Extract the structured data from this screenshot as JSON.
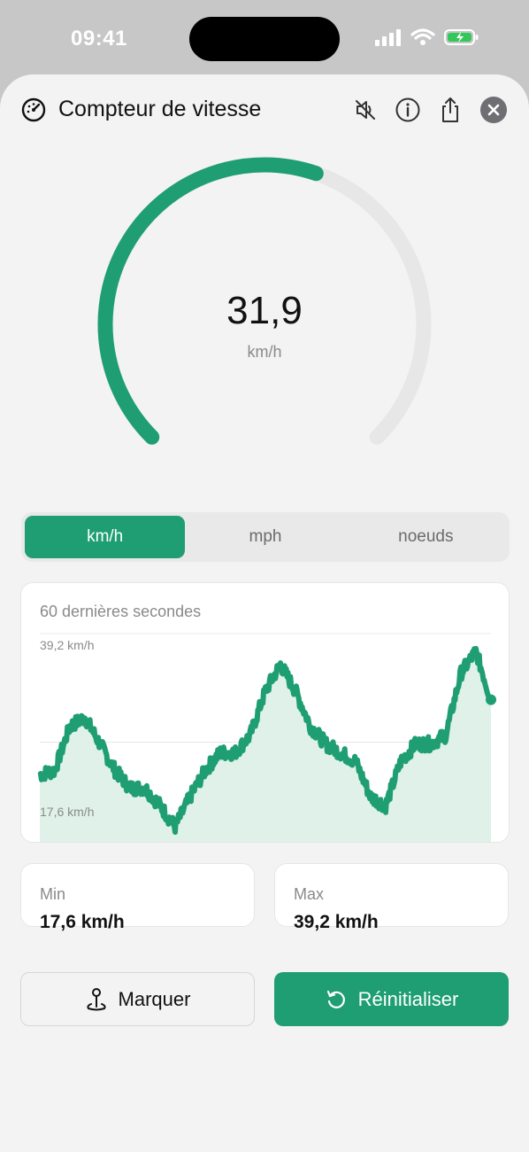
{
  "status": {
    "time": "09:41"
  },
  "header": {
    "title": "Compteur de vitesse",
    "icons": [
      "speedometer-icon",
      "mute-icon",
      "info-icon",
      "share-icon",
      "close-icon"
    ]
  },
  "gauge": {
    "value": "31,9",
    "unit": "km/h",
    "fill_fraction": 0.57
  },
  "units": {
    "options": [
      "km/h",
      "mph",
      "noeuds"
    ],
    "selected": "km/h"
  },
  "chart": {
    "title": "60 dernières secondes",
    "max_label": "39,2 km/h",
    "min_label": "17,6 km/h"
  },
  "chart_data": {
    "type": "area",
    "x": [
      0,
      2,
      4,
      6,
      8,
      10,
      12,
      14,
      16,
      18,
      20,
      22,
      24,
      26,
      28,
      30,
      32,
      34,
      36,
      38,
      40,
      42,
      44,
      46,
      48,
      50,
      52,
      54,
      56,
      58,
      60
    ],
    "values": [
      23.5,
      24,
      29,
      30,
      27,
      24,
      22,
      22,
      20,
      17.6,
      21,
      24,
      26,
      26,
      28,
      33,
      36,
      33,
      29,
      27,
      26,
      25,
      21,
      20,
      25,
      27,
      27,
      28,
      35,
      37.5,
      32
    ],
    "ylim": [
      17.6,
      39.2
    ],
    "xlabel": "",
    "ylabel": ""
  },
  "stats": {
    "min_label": "Min",
    "min_value": "17,6 km/h",
    "max_label": "Max",
    "max_value": "39,2 km/h"
  },
  "actions": {
    "mark_label": "Marquer",
    "reset_label": "Réinitialiser"
  },
  "colors": {
    "accent": "#1e9e72",
    "track": "#e6e7e6",
    "fill": "#dff1e9"
  }
}
